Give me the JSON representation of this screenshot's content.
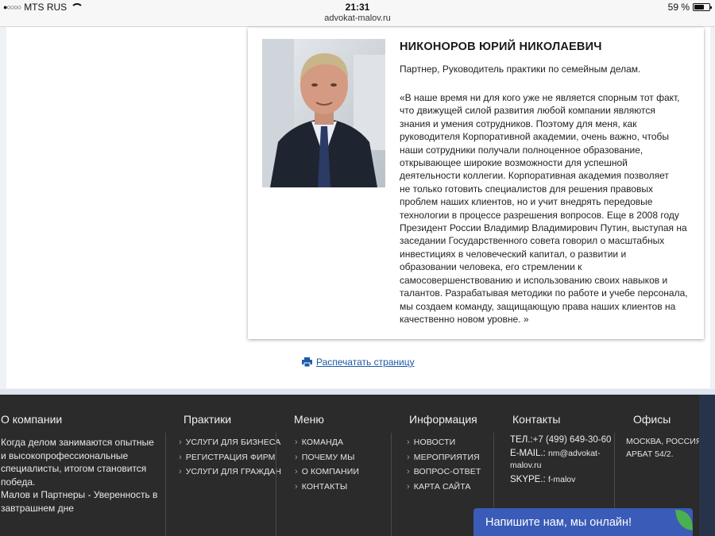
{
  "status": {
    "carrier": "MTS RUS",
    "time": "21:31",
    "url": "advokat-malov.ru",
    "battery": "59 %"
  },
  "profile": {
    "name": "НИКОНОРОВ ЮРИЙ НИКОЛАЕВИЧ",
    "role": "Партнер, Руководитель практики по семейным делам.",
    "quote_lines": [
      "«В наше время ни для кого уже не является спорным тот факт,",
      "что движущей силой развития любой компании являются",
      "знания и умения сотрудников. Поэтому для меня, как",
      "руководителя Корпоративной академии, очень важно, чтобы",
      "наши сотрудники получали полноценное образование,",
      "открывающее широкие возможности для успешной",
      "деятельности коллегии.   Корпоративная академия позволяет",
      "не только готовить специалистов для решения правовых",
      "проблем наших клиентов, но и учит внедрять передовые",
      "технологии в процессе разрешения вопросов.  Еще в 2008 году",
      "Президент России Владимир Владимирович Путин, выступая на",
      "заседании Государственного совета говорил о масштабных",
      "инвестициях в человеческий капитал, о развитии и",
      "образовании человека, его стремлении к",
      "самосовершенствованию и использованию своих навыков и",
      "талантов. Разрабатывая методики по работе и учебе персонала,",
      "мы создаем команду, защищающую права наших клиентов на",
      "качественно новом уровне.  »"
    ]
  },
  "print_label": "Распечатать страницу",
  "footer": {
    "about": {
      "title": "О компании",
      "text": "Когда делом занимаются опытные и высокопрофессиональные специалисты, итогом становится победа.",
      "slogan": "Малов и Партнеры - Уверенность в завтрашнем дне"
    },
    "practices": {
      "title": "Практики",
      "items": [
        "УСЛУГИ ДЛЯ БИЗНЕСА",
        "РЕГИСТРАЦИЯ ФИРМ",
        "УСЛУГИ ДЛЯ ГРАЖДАН"
      ]
    },
    "menu": {
      "title": "Меню",
      "items": [
        "КОМАНДА",
        "ПОЧЕМУ МЫ",
        "О КОМПАНИИ",
        "КОНТАКТЫ"
      ]
    },
    "info": {
      "title": "Информация",
      "items": [
        "НОВОСТИ",
        "МЕРОПРИЯТИЯ",
        "ВОПРОС-ОТВЕТ",
        "КАРТА САЙТА"
      ]
    },
    "contacts": {
      "title": "Контакты",
      "phone_label": "ТЕЛ.:",
      "phone": "+7 (499) 649-30-60",
      "email_label": "E-MAIL.:",
      "email_1": "nm@advokat-",
      "email_2": "malov.ru",
      "skype_label": "SKYPE.:",
      "skype": "f-malov"
    },
    "offices": {
      "title": "Офисы",
      "line1": "МОСКВА, РОССИЯ",
      "line2": "АРБАТ 54/2."
    }
  },
  "chat_label": "Напишите нам, мы онлайн!",
  "colors": {
    "link": "#1d5aa8",
    "footer_bg": "#2b2b2b",
    "chat_bg": "#3a5bb7",
    "chevron": "#7aa7d8"
  }
}
